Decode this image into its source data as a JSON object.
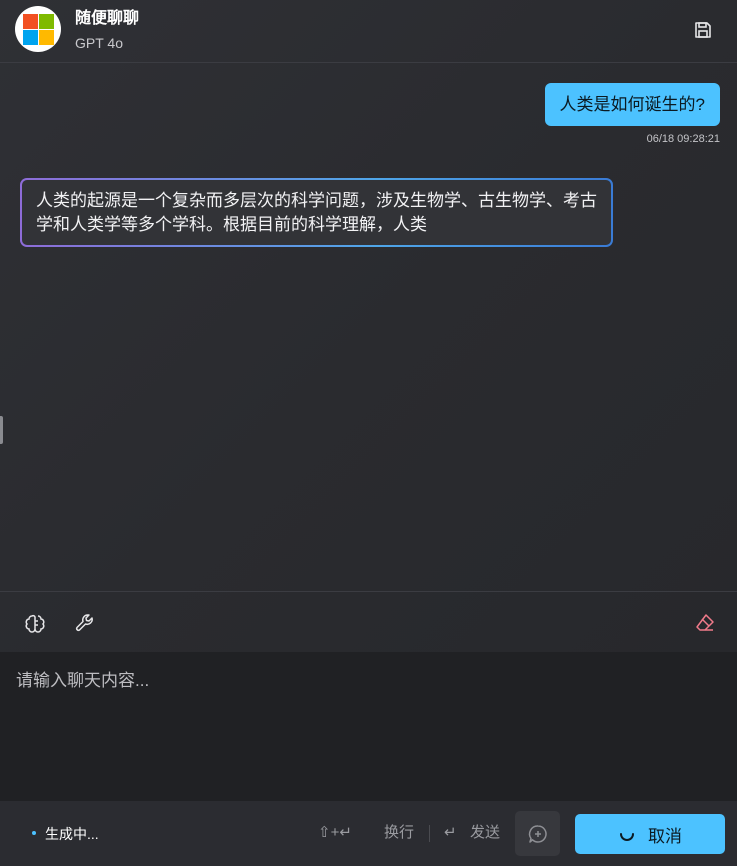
{
  "header": {
    "title": "随便聊聊",
    "subtitle": "GPT 4o"
  },
  "messages": [
    {
      "role": "user",
      "text": "人类是如何诞生的?",
      "time": "06/18 09:28:21"
    },
    {
      "role": "assistant",
      "text": "人类的起源是一个复杂而多层次的科学问题，涉及生物学、古生物学、考古学和人类学等多个学科。根据目前的科学理解，人类"
    }
  ],
  "toolbar": {
    "left_icons": [
      "brain-icon",
      "wrench-icon"
    ],
    "right_icons": [
      "eraser-icon"
    ]
  },
  "input": {
    "placeholder": "请输入聊天内容...",
    "value": ""
  },
  "footer": {
    "status": "生成中...",
    "newline_hint": "换行",
    "newline_symbols": "⇧+↵",
    "send_hint": "发送",
    "send_symbol": "↵",
    "cancel_label": "取消"
  },
  "colors": {
    "accent": "#4cc2ff",
    "eraser": "#f07a8a"
  }
}
